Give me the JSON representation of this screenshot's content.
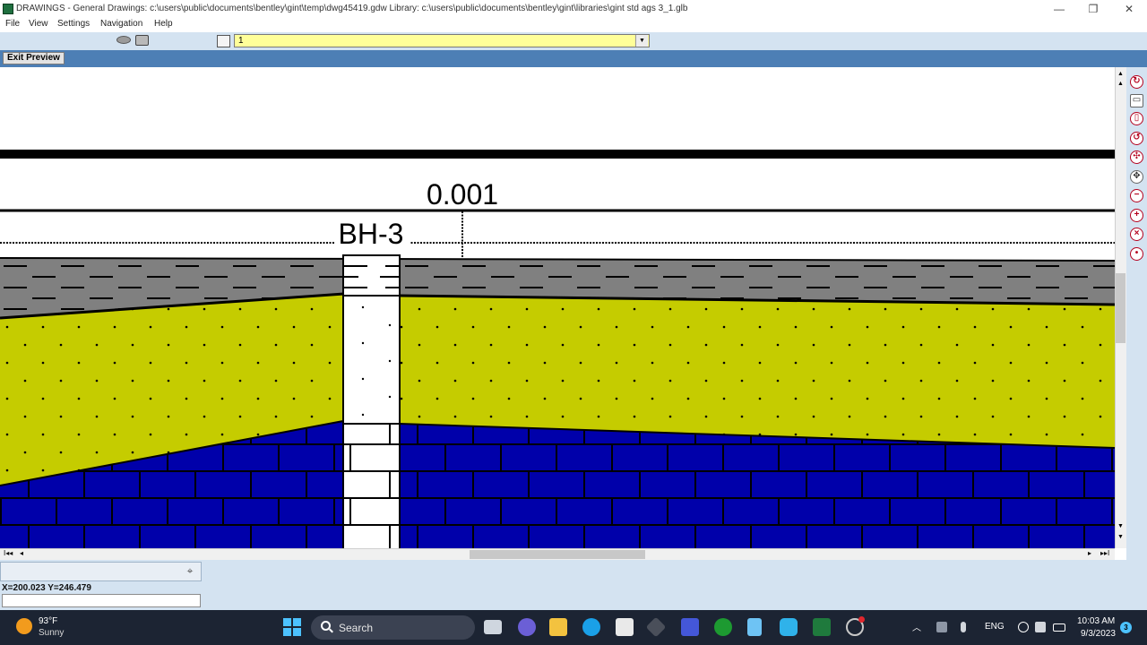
{
  "window": {
    "title": "DRAWINGS -  General Drawings:  c:\\users\\public\\documents\\bentley\\gint\\temp\\dwg45419.gdw  Library: c:\\users\\public\\documents\\bentley\\gint\\libraries\\gint std ags 3_1.glb",
    "minimize": "—",
    "maximize": "❐",
    "close": "✕"
  },
  "menu": {
    "file": "File",
    "view": "View",
    "settings": "Settings",
    "navigation": "Navigation",
    "help": "Help"
  },
  "toolbar": {
    "page_value": "1",
    "dropdown_arrow": "▼"
  },
  "preview": {
    "exit_label": "Exit Preview"
  },
  "drawing": {
    "elevation_label": "0.001",
    "borehole_label": "BH-3",
    "colors": {
      "clay": "#808080",
      "sand": "#c5cc00",
      "rock": "#0000aa",
      "background": "#ffffff",
      "ink": "#000000"
    }
  },
  "scroll": {
    "up": "▲",
    "down": "▼",
    "first": "I◂◂",
    "left": "◂",
    "right": "▸",
    "last": "▸▸I"
  },
  "status": {
    "coordinates": "X=200.023   Y=246.479"
  },
  "taskbar": {
    "weather_temp": "93°F",
    "weather_condition": "Sunny",
    "search_label": "Search",
    "tray_caret": "︿",
    "language": "ENG",
    "time": "10:03 AM",
    "date": "9/3/2023",
    "notification_count": "3"
  }
}
